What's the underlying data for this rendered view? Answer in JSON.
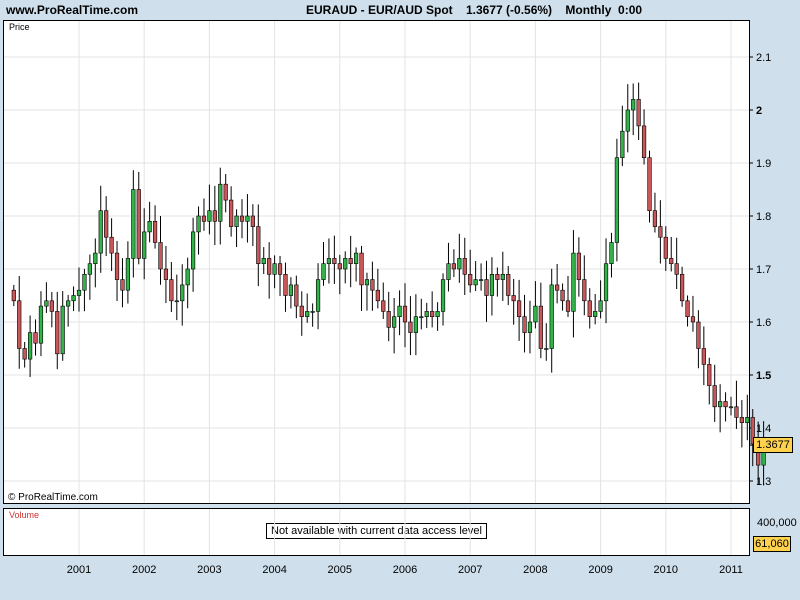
{
  "header": {
    "site": "www.ProRealTime.com",
    "title": "EURAUD - EUR/AUD Spot    1.3677 (-0.56%)    Monthly  0:00"
  },
  "price_panel": {
    "label": "Price",
    "copyright": "© ProRealTime.com"
  },
  "volume_panel": {
    "label": "Volume",
    "notice": "Not available with current data access level",
    "axis_label": "400,000"
  },
  "last_price_tag": "1.3677",
  "volume_tag": "61,060",
  "colors": {
    "up": "#33b24a",
    "down": "#c8575a",
    "wick": "#000000",
    "grid": "#e3e3e3",
    "tag": "#ffd24d",
    "background": "#cfe0ec"
  },
  "chart_data": {
    "type": "candlestick",
    "title": "EURAUD - EUR/AUD Spot",
    "interval": "Monthly",
    "last": "1.3677 (-0.56%)",
    "y_ticks": [
      {
        "value": 1.3,
        "label": "1.3",
        "bold": false
      },
      {
        "value": 1.4,
        "label": "1.4",
        "bold": false
      },
      {
        "value": 1.5,
        "label": "1.5",
        "bold": true
      },
      {
        "value": 1.6,
        "label": "1.6",
        "bold": false
      },
      {
        "value": 1.7,
        "label": "1.7",
        "bold": false
      },
      {
        "value": 1.8,
        "label": "1.8",
        "bold": false
      },
      {
        "value": 1.9,
        "label": "1.9",
        "bold": false
      },
      {
        "value": 2.0,
        "label": "2",
        "bold": true
      },
      {
        "value": 2.1,
        "label": "2.1",
        "bold": false
      }
    ],
    "x_ticks": [
      "2001",
      "2002",
      "2003",
      "2004",
      "2005",
      "2006",
      "2007",
      "2008",
      "2009",
      "2010",
      "2011"
    ],
    "x_start": "2000-01",
    "ylim": [
      1.27,
      2.15
    ],
    "grid": true,
    "closes": [
      1.64,
      1.55,
      1.53,
      1.58,
      1.56,
      1.63,
      1.64,
      1.62,
      1.54,
      1.63,
      1.64,
      1.65,
      1.66,
      1.69,
      1.71,
      1.73,
      1.81,
      1.76,
      1.73,
      1.68,
      1.66,
      1.72,
      1.85,
      1.72,
      1.77,
      1.79,
      1.75,
      1.7,
      1.68,
      1.64,
      1.64,
      1.67,
      1.7,
      1.77,
      1.8,
      1.79,
      1.81,
      1.79,
      1.86,
      1.83,
      1.78,
      1.8,
      1.79,
      1.8,
      1.78,
      1.71,
      1.72,
      1.69,
      1.71,
      1.69,
      1.65,
      1.67,
      1.63,
      1.61,
      1.62,
      1.62,
      1.68,
      1.71,
      1.72,
      1.71,
      1.7,
      1.72,
      1.71,
      1.73,
      1.67,
      1.68,
      1.66,
      1.64,
      1.62,
      1.59,
      1.61,
      1.63,
      1.6,
      1.58,
      1.61,
      1.61,
      1.62,
      1.61,
      1.62,
      1.68,
      1.71,
      1.7,
      1.72,
      1.69,
      1.67,
      1.68,
      1.68,
      1.65,
      1.69,
      1.68,
      1.69,
      1.65,
      1.64,
      1.61,
      1.58,
      1.6,
      1.63,
      1.55,
      1.55,
      1.67,
      1.66,
      1.64,
      1.62,
      1.73,
      1.68,
      1.64,
      1.61,
      1.62,
      1.64,
      1.71,
      1.75,
      1.91,
      1.96,
      2.0,
      2.02,
      1.97,
      1.91,
      1.81,
      1.78,
      1.76,
      1.72,
      1.71,
      1.69,
      1.64,
      1.61,
      1.6,
      1.55,
      1.52,
      1.48,
      1.44,
      1.45,
      1.44,
      1.44,
      1.42,
      1.41,
      1.42,
      1.37,
      1.33,
      1.37
    ]
  }
}
